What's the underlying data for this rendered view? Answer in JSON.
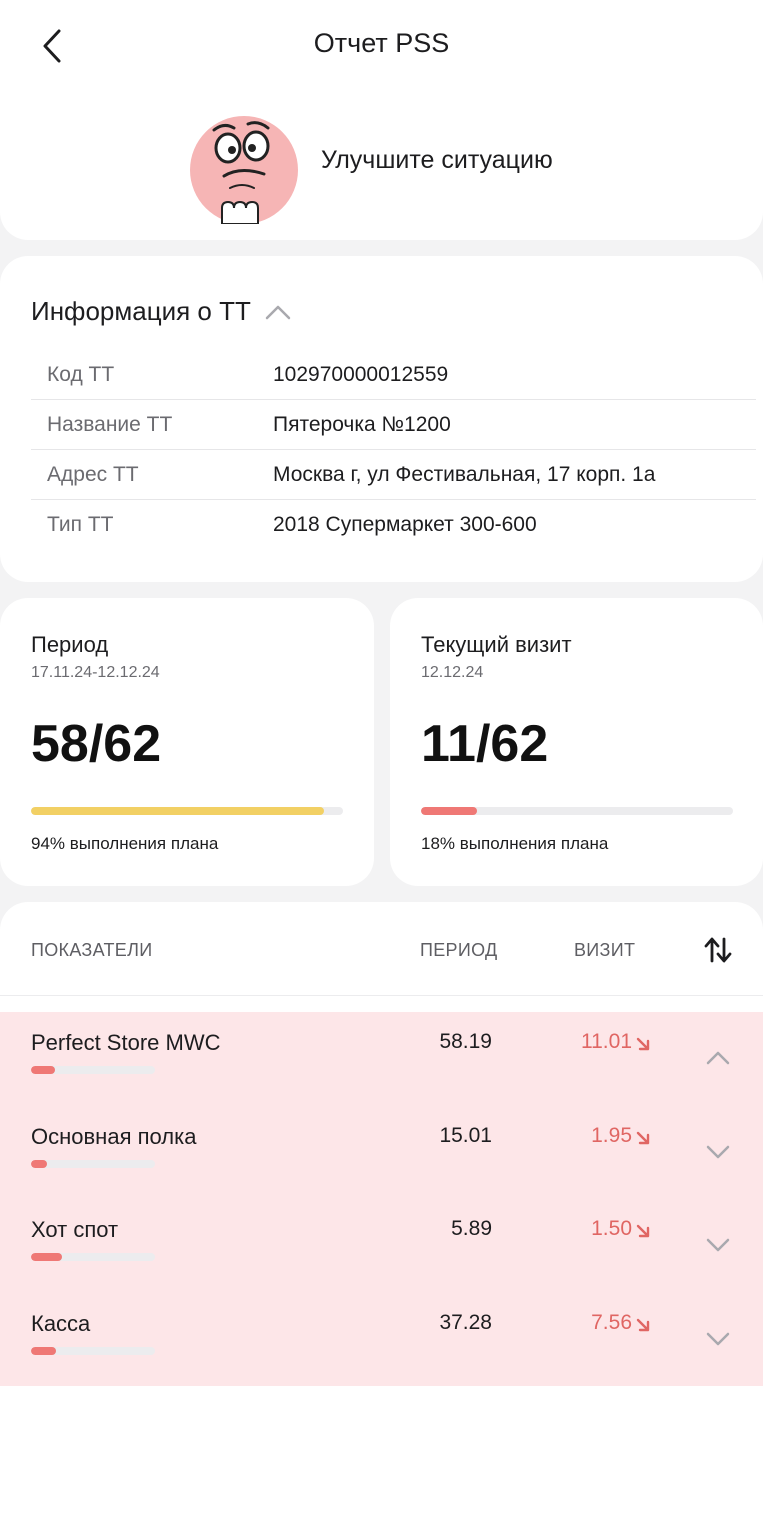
{
  "header": {
    "title": "Отчет PSS",
    "status_text": "Улучшите ситуацию"
  },
  "info": {
    "title": "Информация о ТТ",
    "rows": [
      {
        "label": "Код ТТ",
        "value": "102970000012559"
      },
      {
        "label": "Название ТТ",
        "value": "Пятерочка №1200"
      },
      {
        "label": "Адрес ТТ",
        "value": "Москва г, ул Фестивальная, 17 корп. 1а"
      },
      {
        "label": "Тип ТТ",
        "value": "2018 Супермаркет 300-600"
      }
    ]
  },
  "period": {
    "label": "Период",
    "dates": "17.11.24-12.12.24",
    "value": "58/62",
    "progress": 0.94,
    "note": "94% выполнения плана",
    "bar_color": "#f2d064"
  },
  "visit": {
    "label": "Текущий визит",
    "dates": "12.12.24",
    "value": "11/62",
    "progress": 0.18,
    "note": "18% выполнения плана",
    "bar_color": "#ef7875"
  },
  "table": {
    "col_indicators": "ПОКАЗАТЕЛИ",
    "col_period": "ПЕРИОД",
    "col_visit": "ВИЗИТ",
    "rows": [
      {
        "name": "Perfect Store MWC",
        "period": "58.19",
        "visit": "11.01",
        "progress": 0.19,
        "expanded": true
      },
      {
        "name": "Основная полка",
        "period": "15.01",
        "visit": "1.95",
        "progress": 0.13,
        "expanded": false
      },
      {
        "name": "Хот спот",
        "period": "5.89",
        "visit": "1.50",
        "progress": 0.25,
        "expanded": false
      },
      {
        "name": "Касса",
        "period": "37.28",
        "visit": "7.56",
        "progress": 0.2,
        "expanded": false
      }
    ]
  },
  "colors": {
    "accent_red": "#e06663",
    "row_highlight": "#fde6e8",
    "mascot_pink": "#f6b5b5"
  }
}
